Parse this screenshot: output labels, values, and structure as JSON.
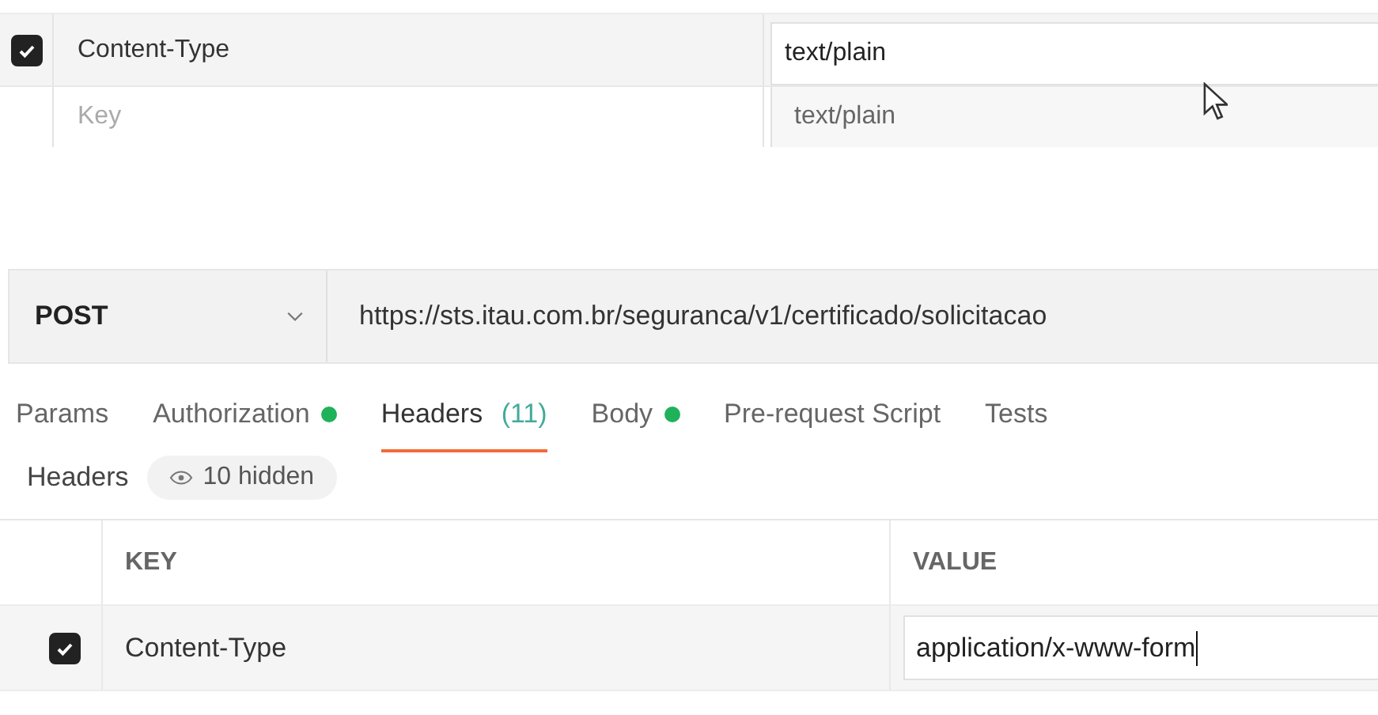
{
  "top_panel": {
    "rows": [
      {
        "kind": "filled",
        "checked": true,
        "key": "Content-Type",
        "value": "text/plain"
      },
      {
        "kind": "new",
        "placeholder": "Key"
      }
    ],
    "suggestions": [
      "text/plain"
    ]
  },
  "request": {
    "method": "POST",
    "url": "https://sts.itau.com.br/seguranca/v1/certificado/solicitacao"
  },
  "tabs": [
    {
      "label": "Params",
      "selected": false,
      "dot": false
    },
    {
      "label": "Authorization",
      "selected": false,
      "dot": true
    },
    {
      "label": "Headers",
      "count": "(11)",
      "selected": true,
      "dot": false
    },
    {
      "label": "Body",
      "selected": false,
      "dot": true
    },
    {
      "label": "Pre-request Script",
      "selected": false,
      "dot": false
    },
    {
      "label": "Tests",
      "selected": false,
      "dot": false
    }
  ],
  "headers_bar": {
    "title": "Headers",
    "hidden": "10 hidden"
  },
  "table": {
    "columns": [
      "KEY",
      "VALUE"
    ],
    "rows": [
      {
        "checked": true,
        "key": "Content-Type",
        "value": "application/x-www-form"
      }
    ]
  }
}
